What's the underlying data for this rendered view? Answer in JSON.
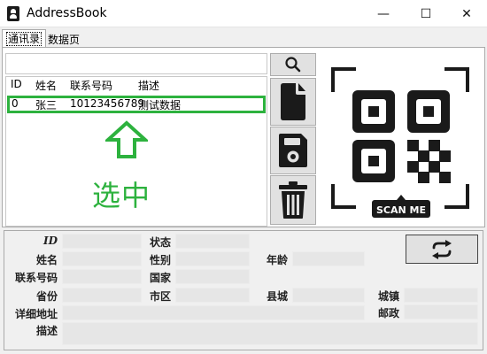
{
  "window": {
    "title": "AddressBook",
    "minimize_glyph": "—",
    "maximize_glyph": "☐",
    "close_glyph": "✕"
  },
  "tabs": [
    {
      "label": "通讯录",
      "active": true
    },
    {
      "label": "数据页",
      "active": false
    }
  ],
  "search": {
    "value": "",
    "placeholder": ""
  },
  "table": {
    "columns": [
      "ID",
      "姓名",
      "联系号码",
      "描述"
    ],
    "rows": [
      {
        "id": "0",
        "name": "张三",
        "phone": "10123456789",
        "desc": "测试数据",
        "selected": true
      }
    ]
  },
  "annotation": {
    "label": "选中",
    "color": "#2db23e"
  },
  "actions": {
    "search_icon": "search-icon",
    "new_icon": "new-file-icon",
    "save_icon": "save-icon",
    "delete_icon": "trash-icon",
    "refresh_icon": "refresh-icon"
  },
  "qr": {
    "caption": "SCAN ME"
  },
  "form": {
    "labels": {
      "id": "ID",
      "status": "状态",
      "name": "姓名",
      "gender": "性别",
      "age": "年龄",
      "phone": "联系号码",
      "country": "国家",
      "province": "省份",
      "district": "市区",
      "county": "县城",
      "town": "城镇",
      "address": "详细地址",
      "postcode": "邮政",
      "desc": "描述"
    },
    "values": {
      "id": "",
      "status": "",
      "name": "",
      "gender": "",
      "age": "",
      "phone": "",
      "country": "",
      "province": "",
      "district": "",
      "county": "",
      "town": "",
      "address": "",
      "postcode": "",
      "desc": ""
    }
  },
  "colors": {
    "highlight": "#2db23e",
    "icon": "#1a1a1a",
    "button_bg": "#e1e1e1"
  }
}
